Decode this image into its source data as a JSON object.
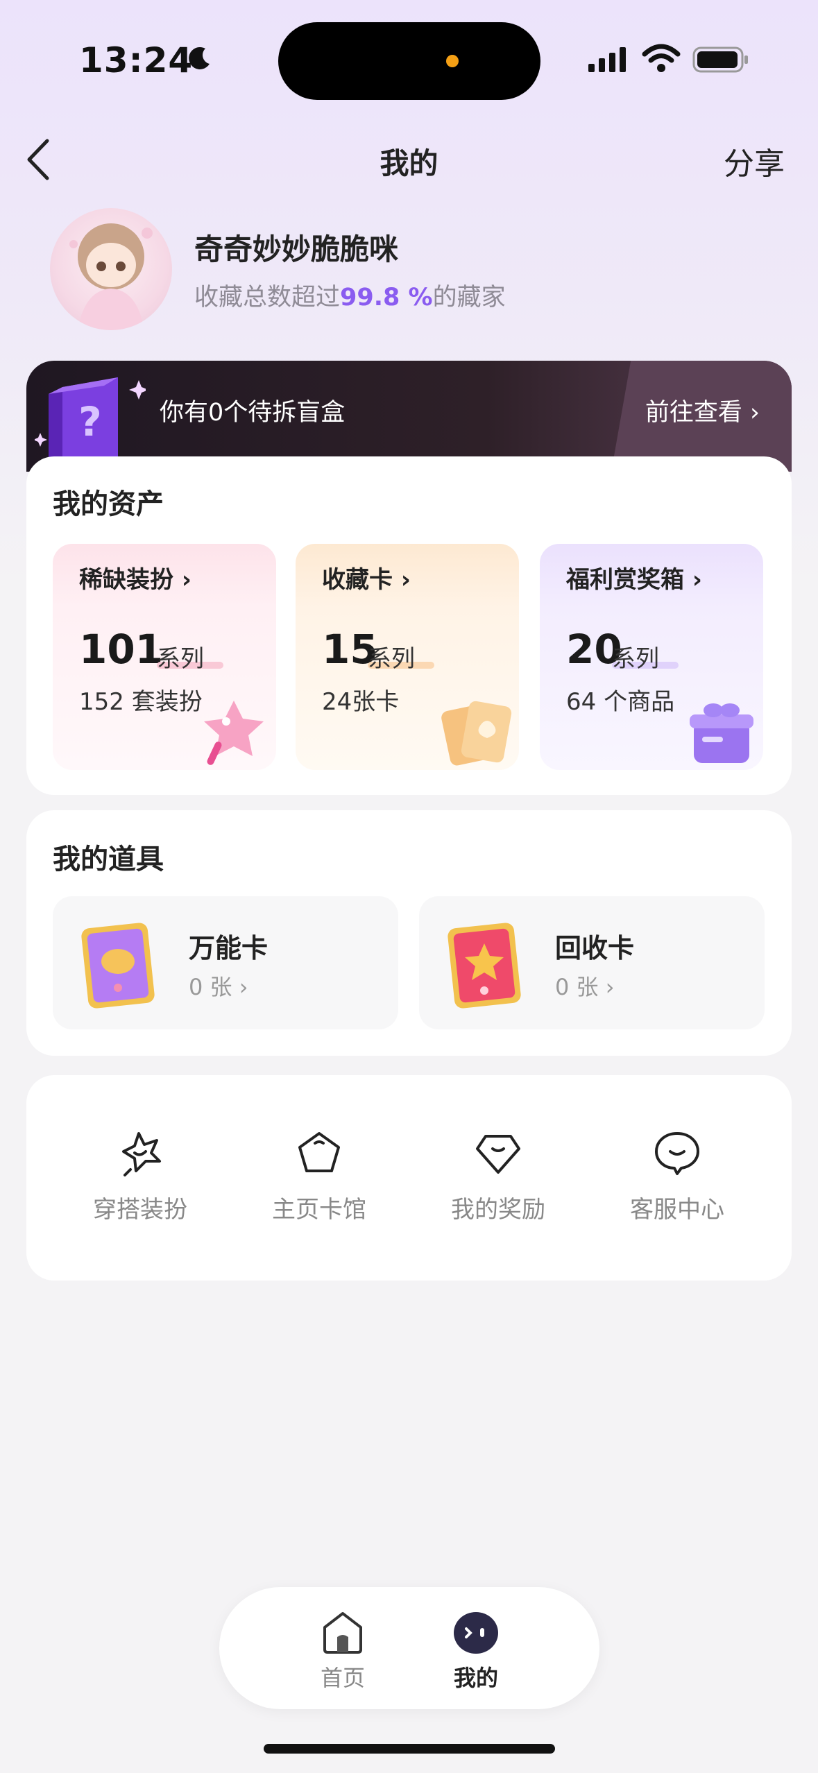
{
  "status_bar": {
    "time": "13:24"
  },
  "nav": {
    "title": "我的",
    "share": "分享"
  },
  "profile": {
    "username": "奇奇妙妙脆脆咪",
    "sub_prefix": "收藏总数超过",
    "sub_percent": "99.8 %",
    "sub_suffix": "的藏家"
  },
  "banner": {
    "text": "你有0个待拆盲盒",
    "link": "前往查看 ›"
  },
  "assets": {
    "title": "我的资产",
    "tiles": [
      {
        "label": "稀缺装扮 ›",
        "count": "101",
        "unit": "系列",
        "sub": "152 套装扮"
      },
      {
        "label": "收藏卡 ›",
        "count": "15",
        "unit": "系列",
        "sub": "24张卡"
      },
      {
        "label": "福利赏奖箱 ›",
        "count": "20",
        "unit": "系列",
        "sub": "64 个商品"
      }
    ]
  },
  "props": {
    "title": "我的道具",
    "items": [
      {
        "name": "万能卡",
        "count": "0 张 ›"
      },
      {
        "name": "回收卡",
        "count": "0 张 ›"
      }
    ]
  },
  "menu": {
    "items": [
      {
        "label": "穿搭装扮",
        "icon": "star-bubble-icon"
      },
      {
        "label": "主页卡馆",
        "icon": "pentagon-icon"
      },
      {
        "label": "我的奖励",
        "icon": "gem-icon"
      },
      {
        "label": "客服中心",
        "icon": "chat-bubble-icon"
      }
    ]
  },
  "tabbar": {
    "items": [
      {
        "label": "首页",
        "active": false
      },
      {
        "label": "我的",
        "active": true
      }
    ]
  },
  "colors": {
    "accent": "#8a5cf0",
    "banner_bg": "#1f1722",
    "text_primary": "#222222",
    "text_muted": "#888888"
  }
}
